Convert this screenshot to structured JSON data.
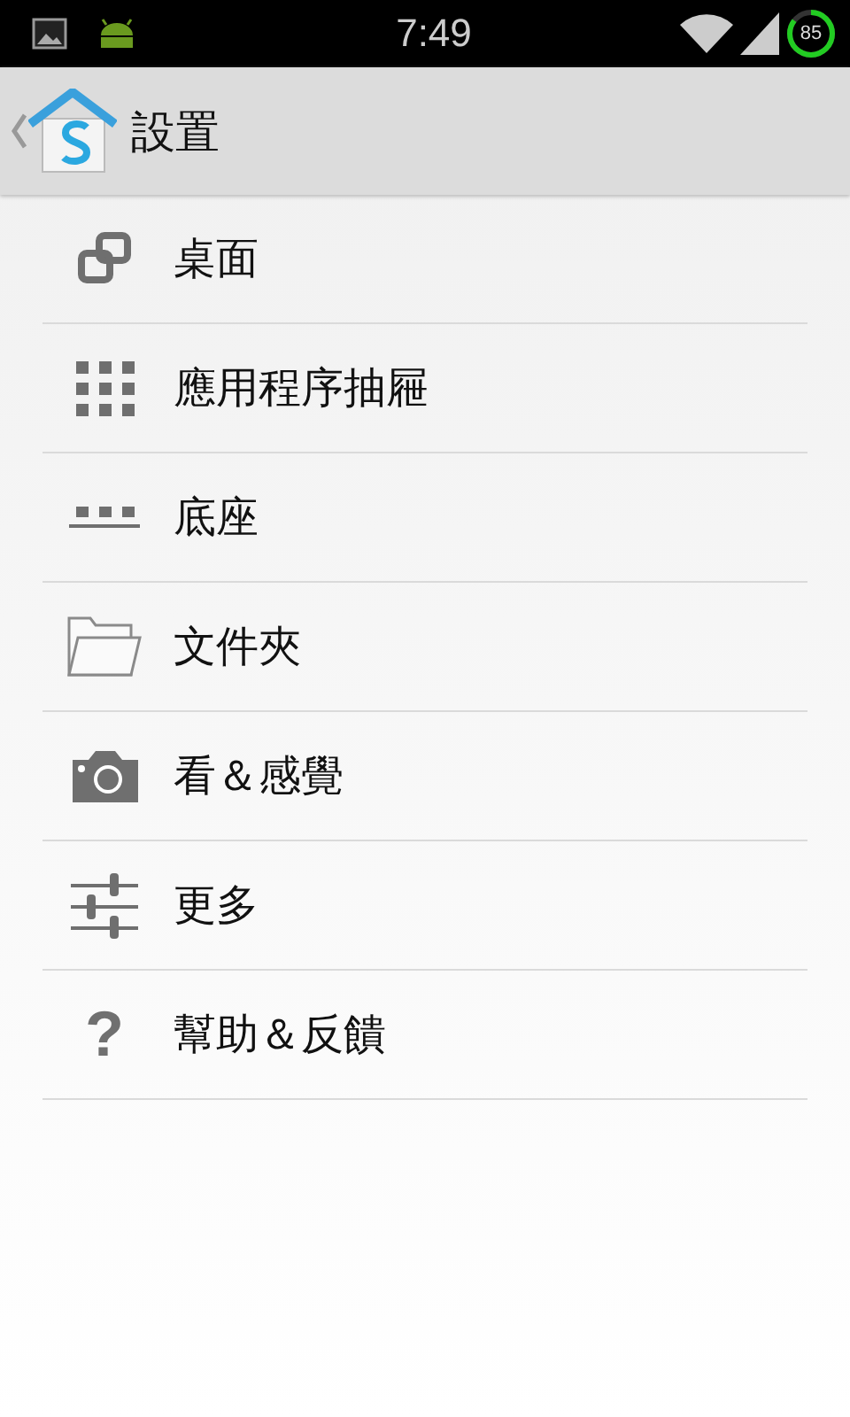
{
  "status_bar": {
    "time": "7:49",
    "battery": "85"
  },
  "app_bar": {
    "title": "設置"
  },
  "items": [
    {
      "label": "桌面"
    },
    {
      "label": "應用程序抽屜"
    },
    {
      "label": "底座"
    },
    {
      "label": "文件夾"
    },
    {
      "label": "看＆感覺"
    },
    {
      "label": "更多"
    },
    {
      "label": "幫助＆反饋",
      "glyph": "?"
    }
  ]
}
